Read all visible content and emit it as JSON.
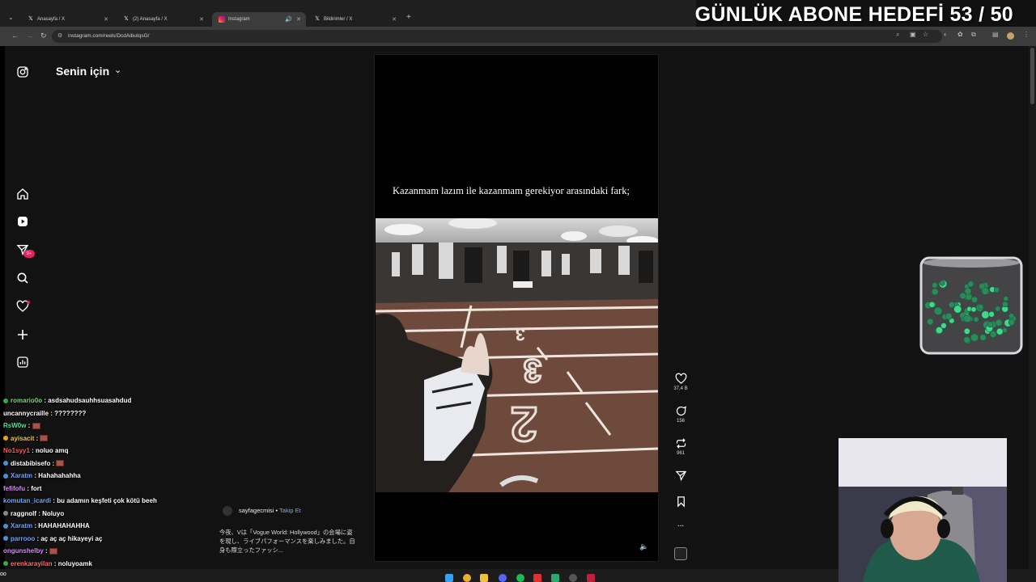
{
  "browser": {
    "tabs": [
      {
        "label": "Anasayfa / X",
        "icon": "x-logo-icon"
      },
      {
        "label": "(2) Anasayfa / X",
        "icon": "x-logo-icon"
      },
      {
        "label": "Instagram",
        "icon": "instagram-logo-icon",
        "active": true
      },
      {
        "label": "Bildirimler / X",
        "icon": "x-logo-icon"
      }
    ],
    "new_tab": "+",
    "url": "instagram.com/reels/DcdAibutqsG/"
  },
  "overlay": {
    "goal": "GÜNLÜK ABONE HEDEFİ 53 / 50"
  },
  "feed": {
    "title": "Senin için",
    "notification_badge": "9+"
  },
  "reel": {
    "caption": "Kazanmam lazım ile kazanmam gerekiyor arasındaki fark;",
    "author": "sayfagecmisi",
    "separator": " • ",
    "follow": "Takip Et",
    "description": "今夜、Vは「Vogue World: Hollywood」の会場に姿を現し、ライブパフォーマンスを楽しみました。自身も際立ったファッシ..."
  },
  "actions": {
    "likes": "37,4 B",
    "comments": "156",
    "reposts": "961",
    "more": "..."
  },
  "chat": [
    {
      "user": "romario0o",
      "text": "asdsahudsauhhsuasahdud",
      "color": "#7cd67c",
      "badge": "#3aa84a"
    },
    {
      "user": "uncannycraille",
      "text": "????????",
      "color": "#ffffff"
    },
    {
      "user": "RsW0w",
      "text": "",
      "color": "#5ee0a0",
      "emote": true
    },
    {
      "user": "ayisacit",
      "text": "",
      "color": "#f2c94c",
      "badge": "#e6a020",
      "emote": true
    },
    {
      "user": "No1syy1",
      "text": "noluo amq",
      "color": "#ff5a5a"
    },
    {
      "user": "distabibisefo",
      "text": "",
      "color": "#ffffff",
      "badge": "#4a90d9",
      "emote": true
    },
    {
      "user": "Xaratm",
      "text": "Hahahahahha",
      "color": "#6fa8ff",
      "badge": "#4a90d9"
    },
    {
      "user": "fefifofu",
      "text": "fort",
      "color": "#d98cff"
    },
    {
      "user": "komutan_icardi",
      "text": "bu adamın keşfeti çok kötü beeh",
      "color": "#6fa8ff"
    },
    {
      "user": "raggnolf",
      "text": "Noluyo",
      "color": "#ffffff",
      "badge": "#888888"
    },
    {
      "user": "Xaratm",
      "text": "HAHAHAHAHHA",
      "color": "#6fa8ff",
      "badge": "#4a90d9"
    },
    {
      "user": "parrooo",
      "text": "aç aç aç hikayeyi aç",
      "color": "#6fa8ff",
      "badge": "#4a90d9"
    },
    {
      "user": "ongunshelby",
      "text": "",
      "color": "#d98cff",
      "emote": true
    },
    {
      "user": "erenkarayilan",
      "text": "noluyoamk",
      "color": "#ff7070",
      "badge": "#3aa84a"
    }
  ],
  "chat_separator": " : ",
  "chat_footer": "oo",
  "colors": {
    "page_bg": "#121212",
    "accent_blue": "#7ea8ff",
    "badge_red": "#e0245e",
    "jar_fill": "#3fd98a"
  }
}
